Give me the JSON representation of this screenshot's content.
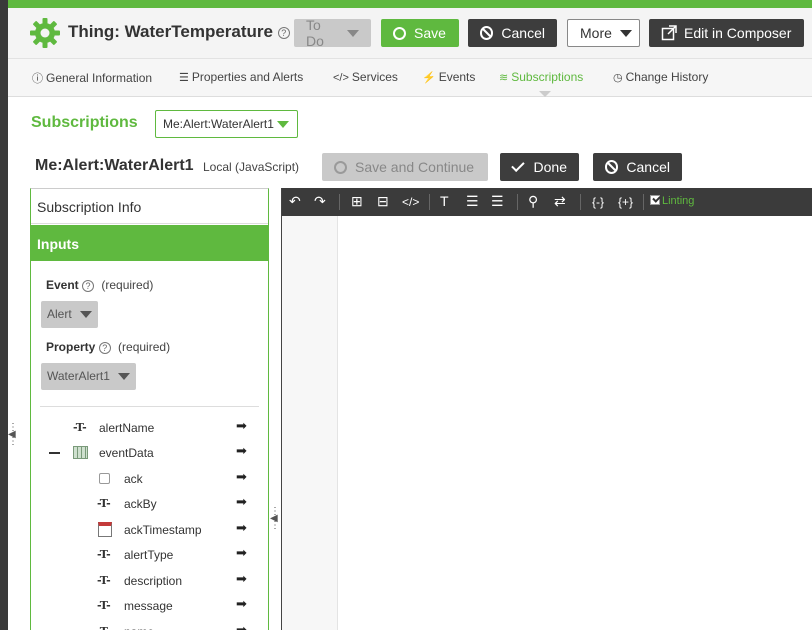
{
  "header": {
    "title": "Thing: WaterTemperature",
    "help_glyph": "?",
    "todo_label": "To Do",
    "save_label": "Save",
    "cancel_label": "Cancel",
    "more_label": "More",
    "composer_label": "Edit in Composer"
  },
  "tabs": [
    {
      "label": "General Information",
      "icon": "info-icon"
    },
    {
      "label": "Properties and Alerts",
      "icon": "list-icon"
    },
    {
      "label": "Services",
      "icon": "code-icon"
    },
    {
      "label": "Events",
      "icon": "bolt-icon"
    },
    {
      "label": "Subscriptions",
      "icon": "rss-icon",
      "active": true
    },
    {
      "label": "Change History",
      "icon": "clock-icon"
    }
  ],
  "subscriptions": {
    "title": "Subscriptions",
    "selected": "Me:Alert:WaterAlert1"
  },
  "subscription": {
    "name": "Me:Alert:WaterAlert1",
    "kind": "Local (JavaScript)",
    "save_continue_label": "Save and Continue",
    "done_label": "Done",
    "cancel_label": "Cancel"
  },
  "panel": {
    "info_label": "Subscription Info",
    "inputs_label": "Inputs",
    "event_label": "Event",
    "property_label": "Property",
    "required_text": "(required)",
    "event_value": "Alert",
    "property_value": "WaterAlert1",
    "fields": [
      {
        "name": "alertName",
        "type": "string",
        "level": 0
      },
      {
        "name": "eventData",
        "type": "infotable",
        "level": 0
      },
      {
        "name": "ack",
        "type": "boolean",
        "level": 1
      },
      {
        "name": "ackBy",
        "type": "string",
        "level": 1
      },
      {
        "name": "ackTimestamp",
        "type": "datetime",
        "level": 1
      },
      {
        "name": "alertType",
        "type": "string",
        "level": 1
      },
      {
        "name": "description",
        "type": "string",
        "level": 1
      },
      {
        "name": "message",
        "type": "string",
        "level": 1
      },
      {
        "name": "name",
        "type": "string",
        "level": 1
      }
    ]
  },
  "editor": {
    "linting_label": "Linting",
    "linting_checked": true
  },
  "colors": {
    "accent": "#5fb93f",
    "dark": "#3d3d3d"
  }
}
